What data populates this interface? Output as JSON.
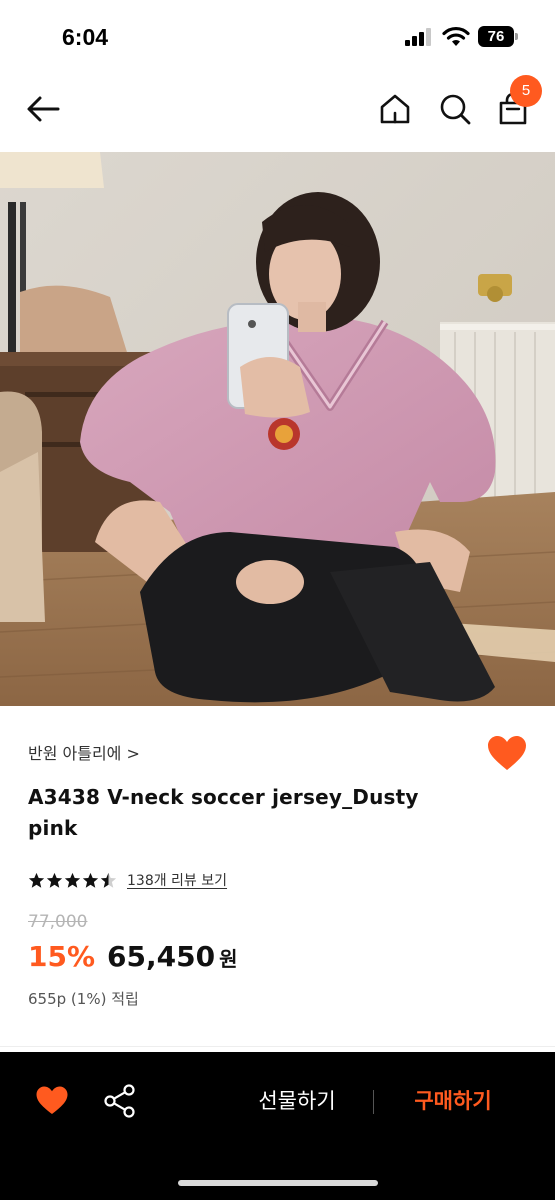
{
  "status_bar": {
    "time": "6:04",
    "battery": "76",
    "icons": [
      "signal-icon",
      "wifi-icon",
      "battery-icon"
    ]
  },
  "nav": {
    "icons": [
      "back-arrow-icon",
      "home-icon",
      "search-icon",
      "shopping-bag-icon"
    ],
    "cart_count": "5",
    "accent_color": "#ff5a1f"
  },
  "product": {
    "image_icon": "product-photo",
    "brand": "반원 아틀리에 >",
    "title": "A3438 V-neck soccer jersey_Dusty pink",
    "rating": 4.5,
    "rating_max": 5,
    "review_link": "138개 리뷰 보기",
    "original_price": "77,000",
    "discount": "15%",
    "sale_price": "65,450",
    "currency": "원",
    "points": "655p (1%) 적립"
  },
  "bottom_bar": {
    "icons": [
      "heart-icon",
      "share-icon"
    ],
    "gift_label": "선물하기",
    "buy_label": "구매하기",
    "background": "#000000"
  }
}
